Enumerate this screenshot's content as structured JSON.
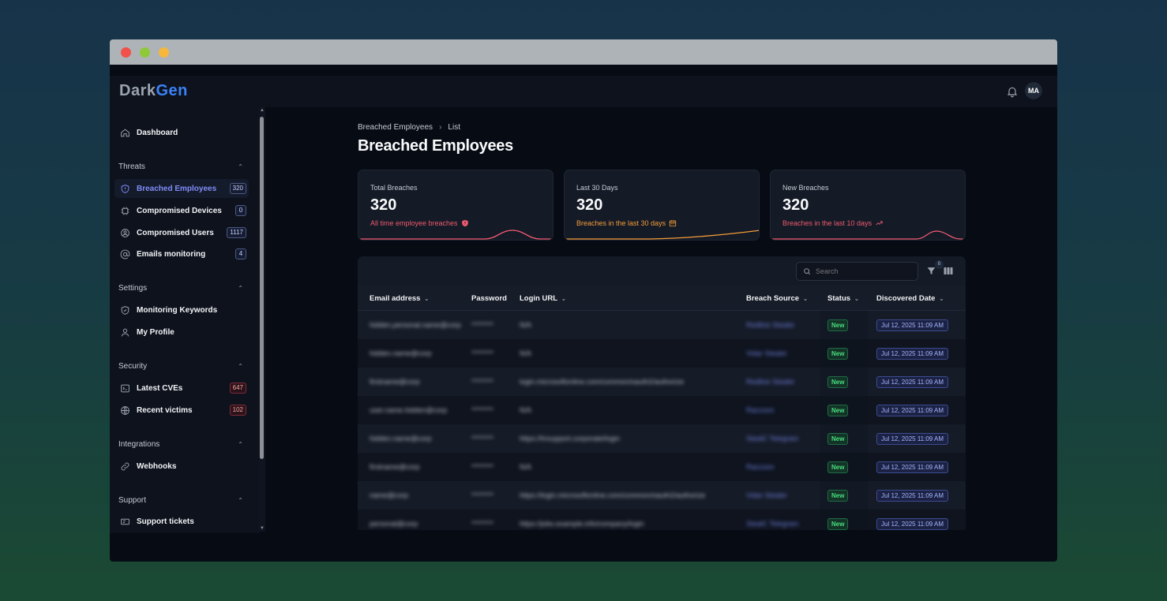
{
  "app": {
    "logo_part1": "Dark",
    "logo_part2": "Gen",
    "user_initials": "MA"
  },
  "sidebar": {
    "dashboard": "Dashboard",
    "sections": {
      "threats": "Threats",
      "settings": "Settings",
      "security": "Security",
      "integrations": "Integrations",
      "support": "Support"
    },
    "items": {
      "breached_employees": {
        "label": "Breached Employees",
        "badge": "320"
      },
      "compromised_devices": {
        "label": "Compromised Devices",
        "badge": "0"
      },
      "compromised_users": {
        "label": "Compromised Users",
        "badge": "1117"
      },
      "emails_monitoring": {
        "label": "Emails monitoring",
        "badge": "4"
      },
      "monitoring_keywords": {
        "label": "Monitoring Keywords"
      },
      "my_profile": {
        "label": "My Profile"
      },
      "latest_cves": {
        "label": "Latest CVEs",
        "badge": "647"
      },
      "recent_victims": {
        "label": "Recent victims",
        "badge": "102"
      },
      "webhooks": {
        "label": "Webhooks"
      },
      "support_tickets": {
        "label": "Support tickets"
      }
    }
  },
  "breadcrumb": {
    "parent": "Breached Employees",
    "current": "List"
  },
  "page_title": "Breached Employees",
  "cards": [
    {
      "label": "Total Breaches",
      "value": "320",
      "sub": "All time employee breaches",
      "color": "#f05b6f"
    },
    {
      "label": "Last 30 Days",
      "value": "320",
      "sub": "Breaches in the last 30 days",
      "color": "#f59e3b"
    },
    {
      "label": "New Breaches",
      "value": "320",
      "sub": "Breaches in the last 10 days",
      "color": "#f05b6f"
    }
  ],
  "toolbar": {
    "search_placeholder": "Search",
    "filter_count": "0"
  },
  "table": {
    "columns": {
      "email": "Email address",
      "password": "Password",
      "login_url": "Login URL",
      "breach_source": "Breach Source",
      "status": "Status",
      "discovered": "Discovered Date"
    },
    "rows": [
      {
        "email": "hidden.personal.name@corp",
        "password": "********",
        "url": "N/A",
        "source": "Redline Stealer",
        "status": "New",
        "date": "Jul 12, 2025 11:09 AM"
      },
      {
        "email": "hidden.name@corp",
        "password": "********",
        "url": "N/A",
        "source": "Vidar Stealer",
        "status": "New",
        "date": "Jul 12, 2025 11:09 AM"
      },
      {
        "email": "firstname@corp",
        "password": "********",
        "url": "login.microsoftonline.com/common/oauth2/authorize",
        "source": "Redline Stealer",
        "status": "New",
        "date": "Jul 12, 2025 11:09 AM"
      },
      {
        "email": "user.name.hidden@corp",
        "password": "********",
        "url": "N/A",
        "source": "Raccoon",
        "status": "New",
        "date": "Jul 12, 2025 11:09 AM"
      },
      {
        "email": "hidden.name@corp",
        "password": "********",
        "url": "https://hrsupport.corporate/login",
        "source": "StealC Telegram",
        "status": "New",
        "date": "Jul 12, 2025 11:09 AM"
      },
      {
        "email": "firstname@corp",
        "password": "********",
        "url": "N/A",
        "source": "Raccoon",
        "status": "New",
        "date": "Jul 12, 2025 11:09 AM"
      },
      {
        "email": "name@corp",
        "password": "********",
        "url": "https://login.microsoftonline.com/common/oauth2/authorize",
        "source": "Vidar Stealer",
        "status": "New",
        "date": "Jul 12, 2025 11:09 AM"
      },
      {
        "email": "personal@corp",
        "password": "********",
        "url": "https://jobs.example.info/company/login",
        "source": "StealC Telegram",
        "status": "New",
        "date": "Jul 12, 2025 11:09 AM"
      }
    ]
  }
}
